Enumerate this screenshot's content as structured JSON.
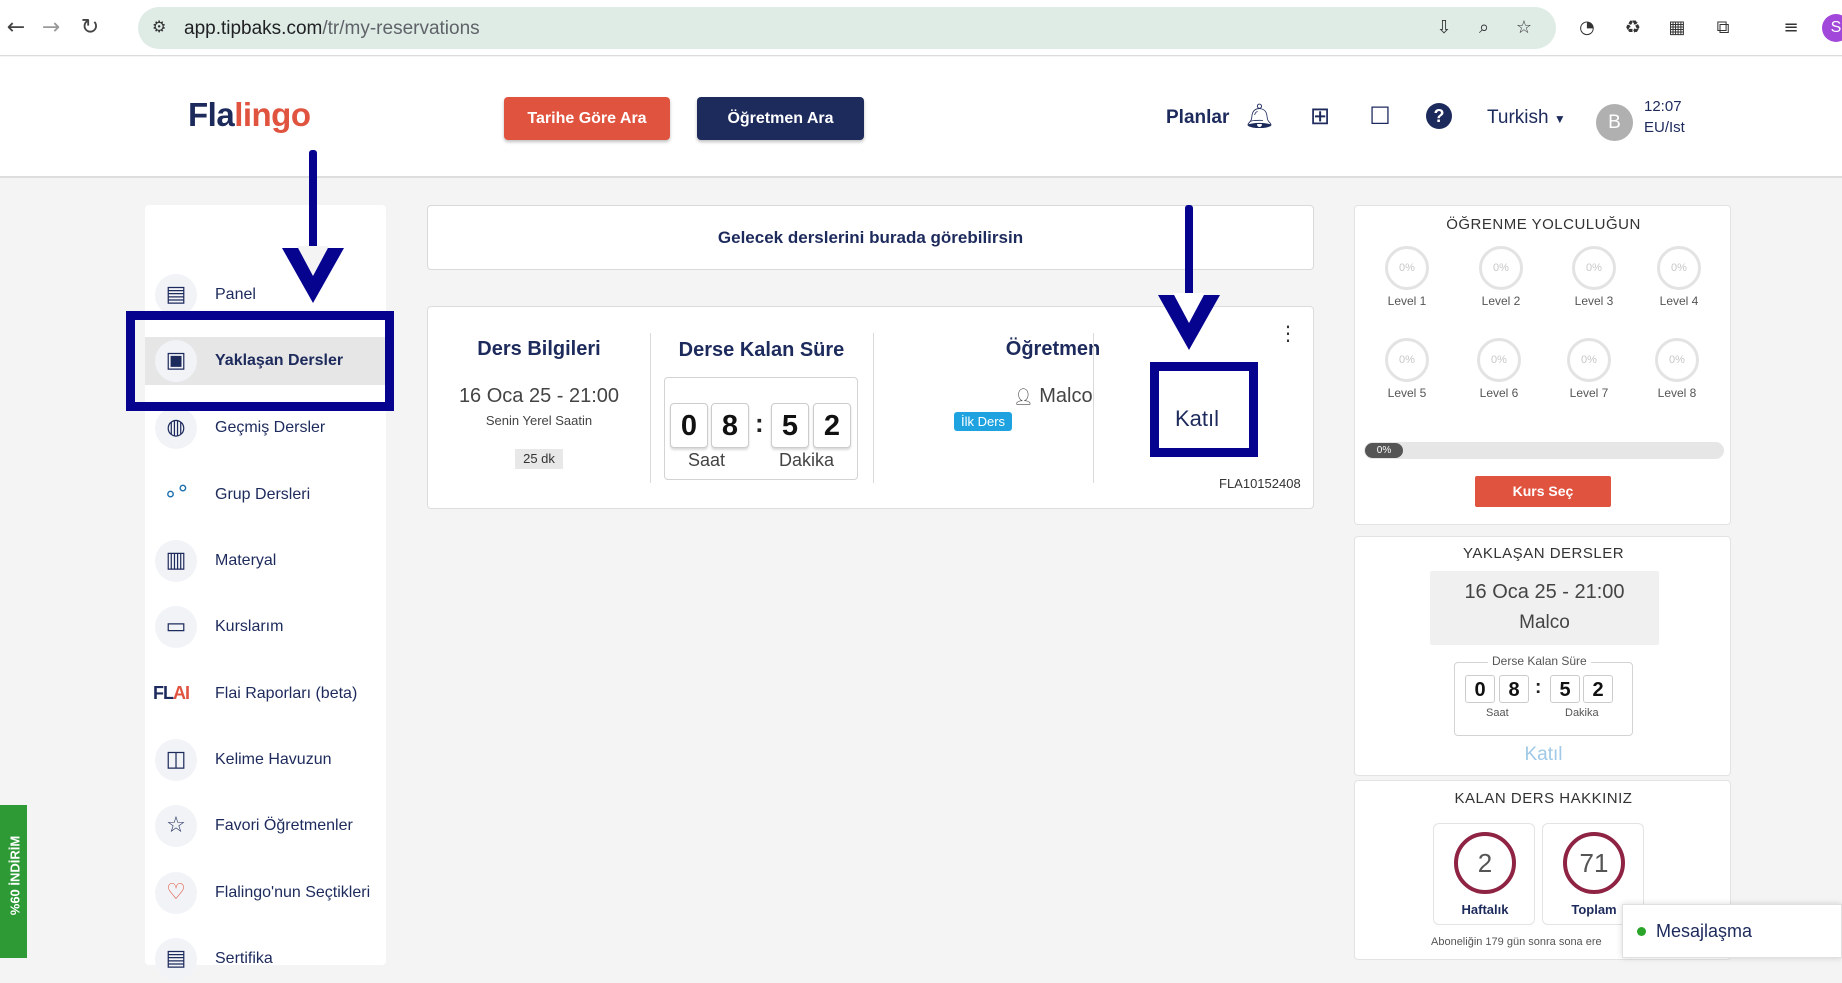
{
  "browser": {
    "back_icon": "arrow-left-icon",
    "forward_icon": "arrow-right-icon",
    "reload_icon": "reload-icon",
    "url_host": "app.tipbaks.com",
    "url_path": "/tr/my-reservations",
    "profile_initial": "S"
  },
  "header": {
    "logo_main": "Fla",
    "logo_accent": "lingo",
    "search_by_date": "Tarihe Göre Ara",
    "search_teacher": "Öğretmen Ara",
    "plans": "Planlar",
    "language": "Turkish",
    "avatar_initial": "B",
    "time": "12:07",
    "timezone": "EU/Ist"
  },
  "sidebar": {
    "items": [
      {
        "label": "Panel",
        "icon": "notebook-icon"
      },
      {
        "label": "Yaklaşan Dersler",
        "icon": "upcoming-lessons-icon"
      },
      {
        "label": "Geçmiş Dersler",
        "icon": "globe-icon"
      },
      {
        "label": "Grup Dersleri",
        "icon": "group-icon"
      },
      {
        "label": "Materyal",
        "icon": "document-icon"
      },
      {
        "label": "Kurslarım",
        "icon": "monitor-icon"
      },
      {
        "label": "Flai Raporları (beta)",
        "icon": "flai-logo"
      },
      {
        "label": "Kelime Havuzun",
        "icon": "vocabulary-icon"
      },
      {
        "label": "Favori Öğretmenler",
        "icon": "star-icon"
      },
      {
        "label": "Flalingo'nun Seçtikleri",
        "icon": "people-heart-icon"
      },
      {
        "label": "Sertifika",
        "icon": "certificate-icon"
      }
    ],
    "flai_logo": "FL",
    "flai_logo_accent": "AI"
  },
  "main": {
    "banner": "Gelecek derslerini burada görebilirsin",
    "reservation": {
      "info_title": "Ders Bilgileri",
      "date": "16 Oca 25 - 21:00",
      "local_time_note": "Senin Yerel Saatin",
      "duration": "25 dk",
      "countdown_title": "Derse Kalan Süre",
      "digits": [
        "0",
        "8",
        "5",
        "2"
      ],
      "hours_label": "Saat",
      "minutes_label": "Dakika",
      "teacher_title": "Öğretmen",
      "teacher_name": "Malco",
      "first_lesson_badge": "İlk Ders",
      "join": "Katıl",
      "reservation_id": "FLA10152408"
    }
  },
  "learning_journey": {
    "title": "ÖĞRENME YOLCULUĞUN",
    "levels": [
      {
        "label": "Level 1",
        "percent": "0%"
      },
      {
        "label": "Level 2",
        "percent": "0%"
      },
      {
        "label": "Level 3",
        "percent": "0%"
      },
      {
        "label": "Level 4",
        "percent": "0%"
      },
      {
        "label": "Level 5",
        "percent": "0%"
      },
      {
        "label": "Level 6",
        "percent": "0%"
      },
      {
        "label": "Level 7",
        "percent": "0%"
      },
      {
        "label": "Level 8",
        "percent": "0%"
      }
    ],
    "overall_progress": "0%",
    "select_course": "Kurs Seç"
  },
  "upcoming": {
    "title": "YAKLAŞAN DERSLER",
    "date": "16 Oca 25 - 21:00",
    "teacher": "Malco",
    "countdown_title": "Derse Kalan Süre",
    "digits": [
      "0",
      "8",
      "5",
      "2"
    ],
    "hours_label": "Saat",
    "minutes_label": "Dakika",
    "join": "Katıl"
  },
  "remaining": {
    "title": "KALAN DERS HAKKINIZ",
    "weekly_value": "2",
    "weekly_label": "Haftalık",
    "total_value": "71",
    "total_label": "Toplam",
    "subscription_note": "Aboneliğin 179 gün sonra sona ere"
  },
  "chat": {
    "label": "Mesajlaşma"
  },
  "promo": {
    "label": "%60 İNDİRİM"
  },
  "colors": {
    "navy": "#1d2a5c",
    "red": "#e0533f",
    "annotation": "#06038f"
  }
}
